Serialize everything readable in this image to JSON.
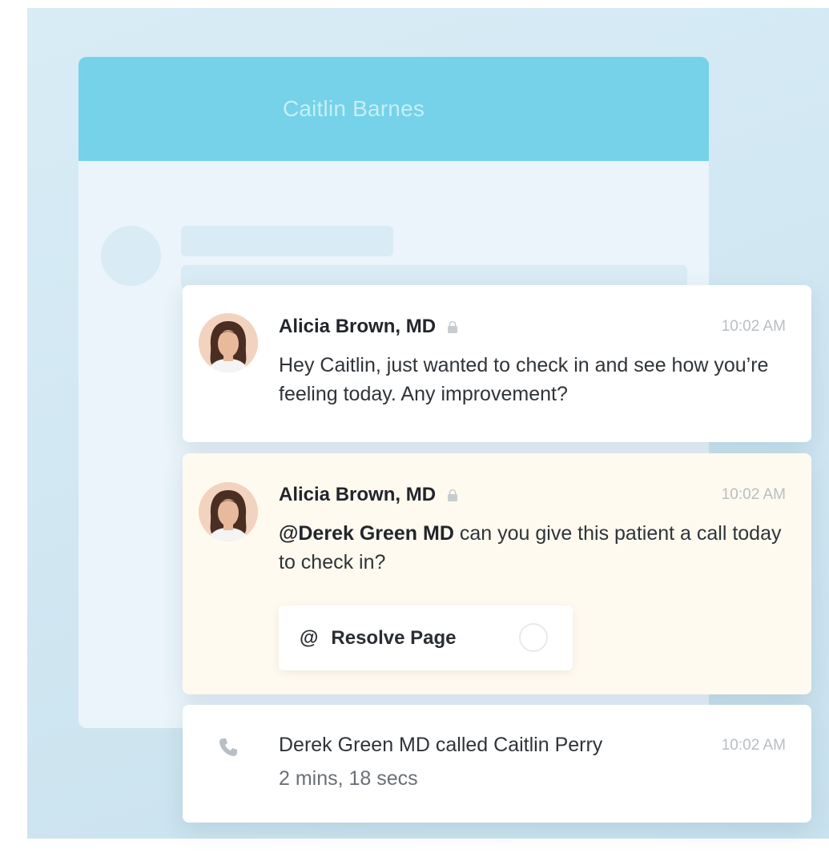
{
  "patient_window": {
    "title": "Caitlin Barnes"
  },
  "messages": [
    {
      "author": "Alicia Brown, MD",
      "time": "10:02 AM",
      "text": "Hey Caitlin, just wanted to check in and see how you’re feeling today. Any improvement?",
      "avatar_icon": "doctor-avatar"
    },
    {
      "author": "Alicia Brown, MD",
      "time": "10:02 AM",
      "mention": "@Derek Green MD",
      "text": " can you give this patient a call today to check in?",
      "avatar_icon": "doctor-avatar",
      "background": "#fffaf0",
      "resolve_button": {
        "at_symbol": "@",
        "label": "Resolve Page"
      }
    }
  ],
  "call_log": {
    "icon": "phone-icon",
    "text": "Derek Green MD called Caitlin Perry",
    "time": "10:02 AM",
    "duration": "2 mins, 18 secs"
  },
  "colors": {
    "header": "#75d2e8",
    "background": "#d8ecf5",
    "highlight": "#fffaf0"
  }
}
